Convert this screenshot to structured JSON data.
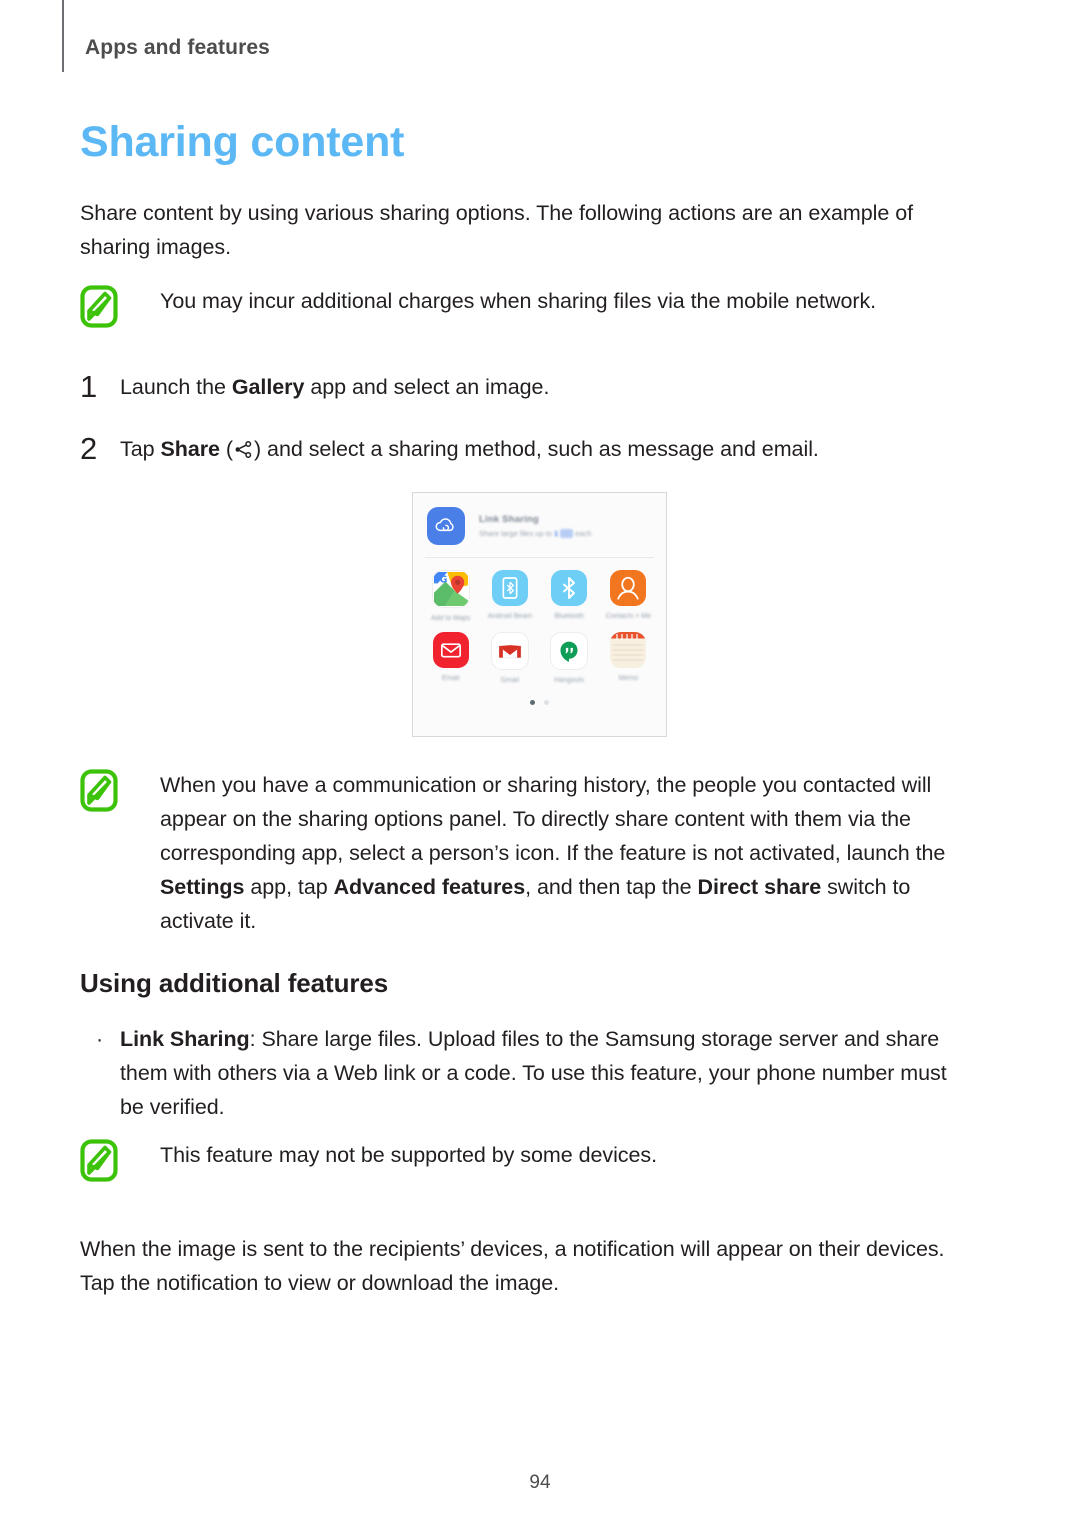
{
  "header": {
    "section": "Apps and features"
  },
  "heading": "Sharing content",
  "intro": "Share content by using various sharing options. The following actions are an example of sharing images.",
  "notes": [
    {
      "icon": "samsung-note-icon",
      "text": "You may incur additional charges when sharing files via the mobile network."
    },
    {
      "icon": "samsung-note-icon",
      "text_parts": [
        {
          "t": "When you have a communication or sharing history, the people you contacted will appear on the sharing options panel. To directly share content with them via the corresponding app, select a person’s icon. If the feature is not activated, launch the ",
          "b": false
        },
        {
          "t": "Settings",
          "b": true
        },
        {
          "t": " app, tap ",
          "b": false
        },
        {
          "t": "Advanced features",
          "b": true
        },
        {
          "t": ", and then tap the ",
          "b": false
        },
        {
          "t": "Direct share",
          "b": true
        },
        {
          "t": " switch to activate it.",
          "b": false
        }
      ]
    },
    {
      "icon": "samsung-note-icon",
      "text": "This feature may not be supported by some devices."
    }
  ],
  "steps": [
    {
      "num": "1",
      "parts": [
        {
          "t": "Launch the ",
          "b": false
        },
        {
          "t": "Gallery",
          "b": true
        },
        {
          "t": " app and select an image.",
          "b": false
        }
      ]
    },
    {
      "num": "2",
      "parts": [
        {
          "t": "Tap ",
          "b": false
        },
        {
          "t": "Share",
          "b": true
        },
        {
          "t": " (",
          "b": false
        },
        {
          "t": "[share-icon]",
          "b": false
        },
        {
          "t": ") and select a sharing method, such as message and email.",
          "b": false
        }
      ]
    }
  ],
  "screenshot": {
    "link_sharing": {
      "icon": "cloud-link-icon",
      "title": "Link Sharing",
      "subtitle_prefix": "Share large files up to ",
      "subtitle_value": "1",
      "subtitle_unit": "GB",
      "subtitle_suffix": " each"
    },
    "apps": [
      {
        "name": "Add to Maps",
        "icon": "google-maps-icon"
      },
      {
        "name": "Android Beam",
        "icon": "android-beam-icon"
      },
      {
        "name": "Bluetooth",
        "icon": "bluetooth-icon"
      },
      {
        "name": "Contacts > Me",
        "icon": "contacts-icon"
      },
      {
        "name": "Email",
        "icon": "email-icon"
      },
      {
        "name": "Gmail",
        "icon": "gmail-icon"
      },
      {
        "name": "Hangouts",
        "icon": "hangouts-icon"
      },
      {
        "name": "Memo",
        "icon": "memo-icon"
      }
    ],
    "page_dots": 2,
    "active_dot": 0
  },
  "subheading": "Using additional features",
  "bullet": {
    "marker": "·",
    "parts": [
      {
        "t": "Link Sharing",
        "b": true
      },
      {
        "t": ": Share large files. Upload files to the Samsung storage server and share them with others via a Web link or a code. To use this feature, your phone number must be verified.",
        "b": false
      }
    ]
  },
  "outro": "When the image is sent to the recipients’ devices, a notification will appear on their devices. Tap the notification to view or download the image.",
  "page_number": "94",
  "colors": {
    "heading_blue": "#5cb8f5",
    "note_green": "#3dc20a",
    "text": "#231f20"
  }
}
